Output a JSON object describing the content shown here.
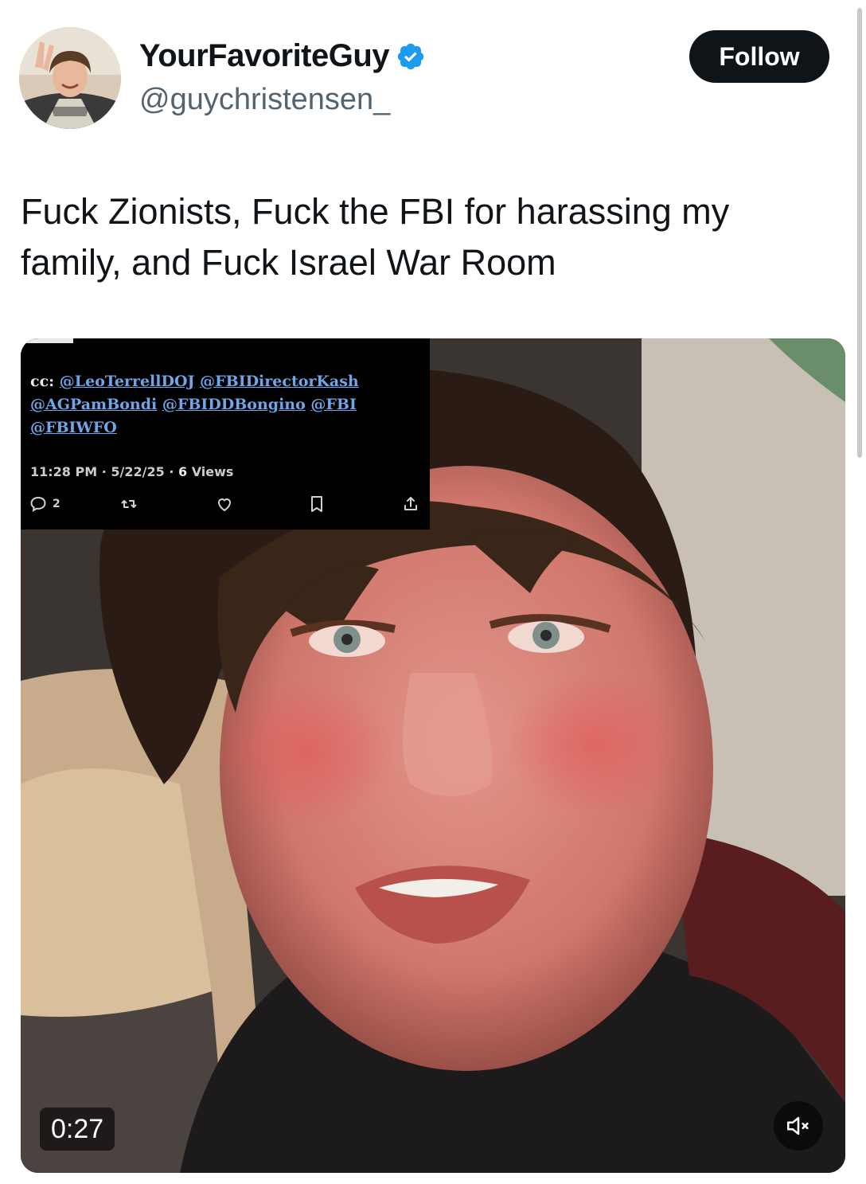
{
  "author": {
    "display_name": "YourFavoriteGuy",
    "handle": "@guychristensen_",
    "verified": true,
    "avatar_icon": "profile-photo",
    "verified_color": "#1d9bf0"
  },
  "follow_button": {
    "label": "Follow"
  },
  "tweet": {
    "text": "Fuck Zionists, Fuck the FBI for harassing my family, and Fuck Israel War Room"
  },
  "video": {
    "timestamp": "0:27",
    "mute_icon": "speaker-muted-icon",
    "embedded_screenshot": {
      "cc_prefix": "cc:",
      "mentions": [
        "@LeoTerrellDOJ",
        "@FBIDirectorKash",
        "@AGPamBondi",
        "@FBIDDBongino",
        "@FBI",
        "@FBIWFO"
      ],
      "time": "11:28 PM",
      "date": "5/22/25",
      "views_count": "6",
      "views_label": "Views",
      "reply_count": "2"
    }
  },
  "colors": {
    "text": "#0f1419",
    "muted": "#536471",
    "link": "#6fa6e8",
    "accent": "#1d9bf0"
  }
}
